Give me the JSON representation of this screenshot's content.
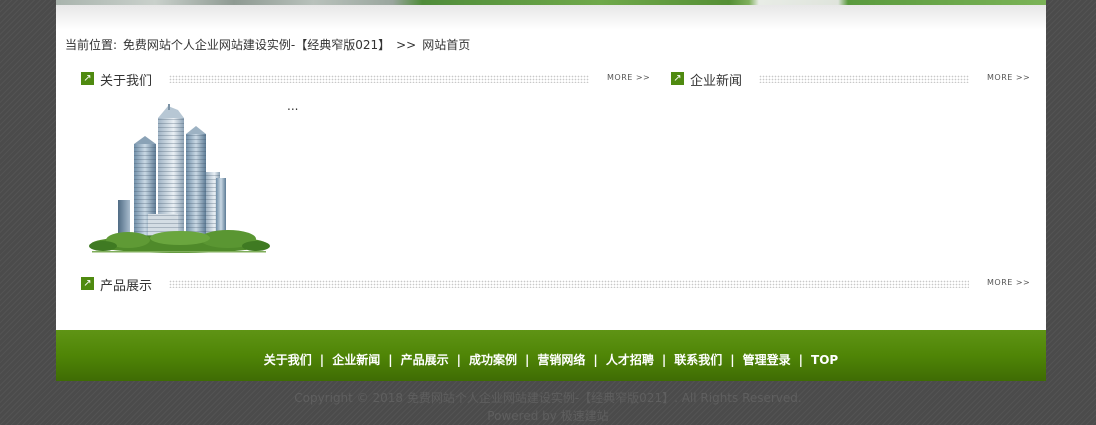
{
  "breadcrumb": {
    "prefix": "当前位置: ",
    "site_link": "免费网站个人企业网站建设实例-【经典窄版021】",
    "separator": ">>",
    "current": "网站首页"
  },
  "sections": {
    "about": {
      "title": "关于我们",
      "more": "MORE >>",
      "content": "..."
    },
    "news": {
      "title": "企业新闻",
      "more": "MORE >>"
    },
    "products": {
      "title": "产品展示",
      "more": "MORE >>"
    }
  },
  "footer": {
    "nav": [
      "关于我们",
      "企业新闻",
      "产品展示",
      "成功案例",
      "营销网络",
      "人才招聘",
      "联系我们",
      "管理登录",
      "TOP"
    ],
    "separator": "|",
    "copyright": "Copyright © 2018 免费网站个人企业网站建设实例-【经典窄版021】. All Rights Reserved.",
    "powered_prefix": "Powered by ",
    "powered_link": "极速建站"
  },
  "colors": {
    "accent_green": "#4f8506",
    "page_background": "#4b4b4b",
    "content_background": "#ffffff"
  },
  "icons": {
    "section": "arrow-up-right-icon",
    "building": "building-photo"
  }
}
